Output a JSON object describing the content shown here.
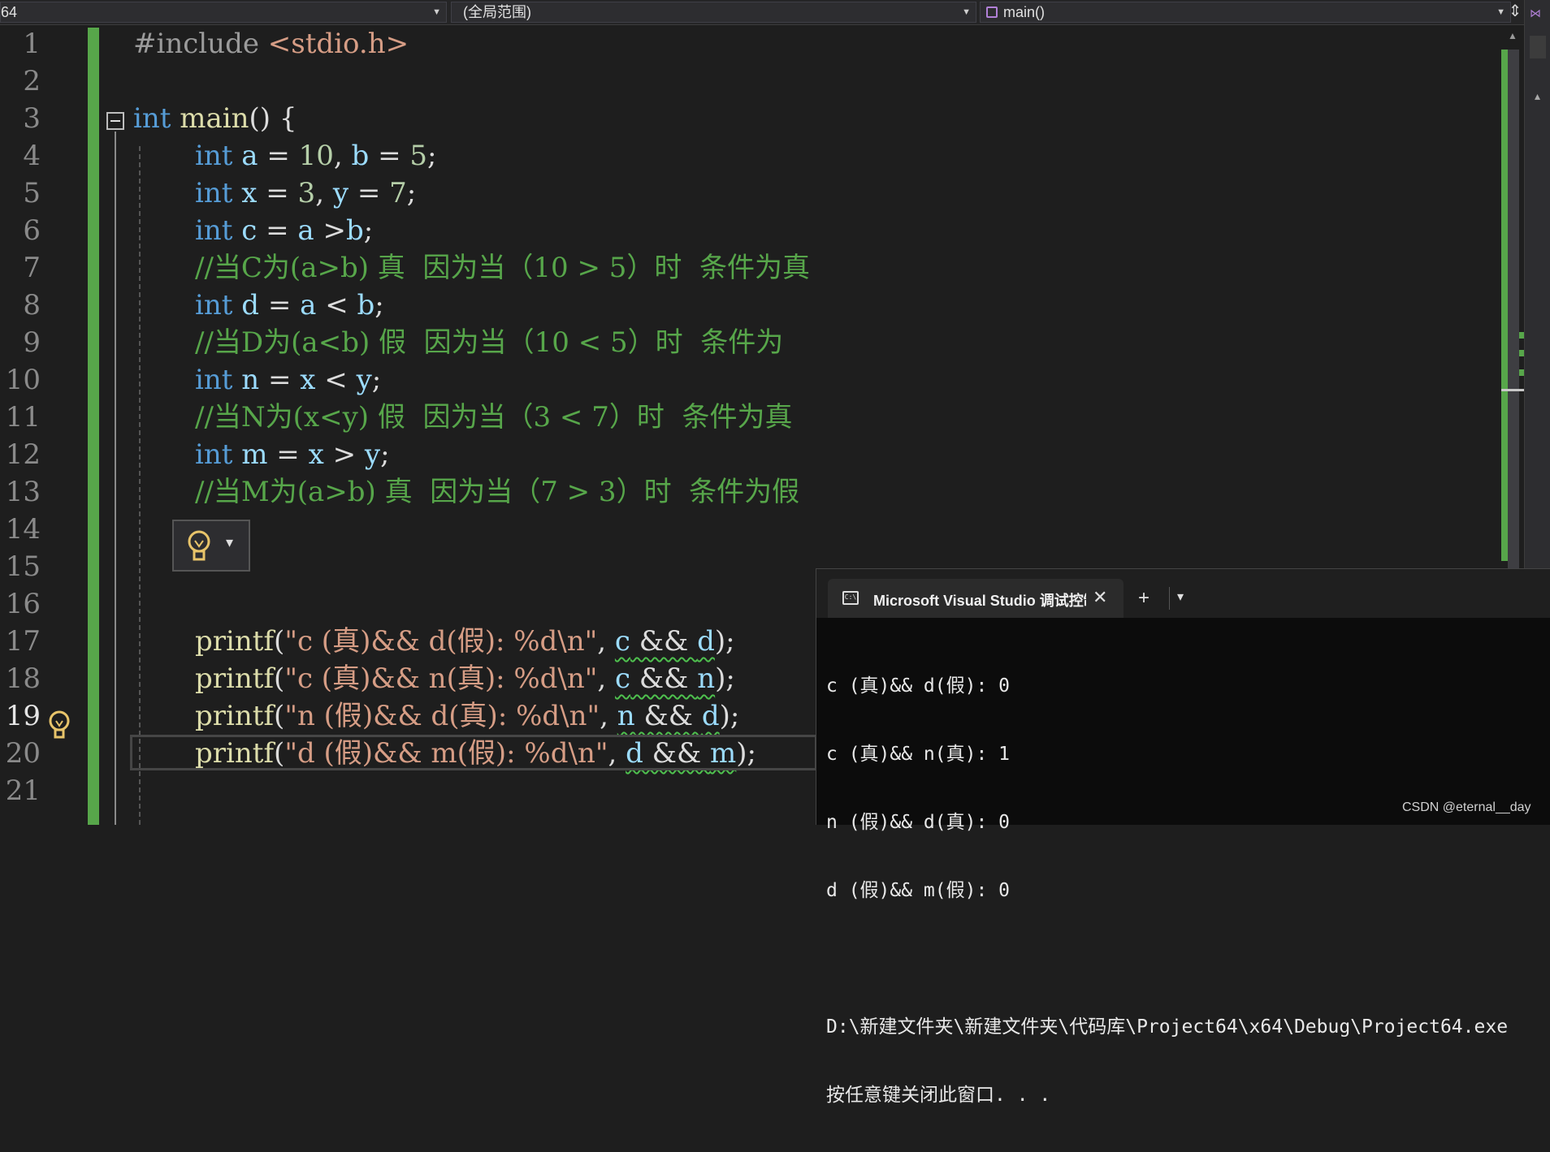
{
  "navbar": {
    "project": "64",
    "scope": "(全局范围)",
    "member": "main()"
  },
  "line_numbers": [
    "1",
    "2",
    "3",
    "4",
    "5",
    "6",
    "7",
    "8",
    "9",
    "10",
    "11",
    "12",
    "13",
    "14",
    "15",
    "16",
    "17",
    "18",
    "19",
    "20",
    "21"
  ],
  "code": {
    "l1_pp": "#include ",
    "l1_inc": "<stdio.h>",
    "l3_kw": "int",
    "l3_fn": "main",
    "l3_rest": "() {",
    "l4": {
      "kw": "int",
      "v1": "a",
      "op1": " = ",
      "n1": "10",
      "sep": ", ",
      "v2": "b",
      "op2": " = ",
      "n2": "5",
      "end": ";"
    },
    "l5": {
      "kw": "int",
      "v1": "x",
      "op1": " = ",
      "n1": "3",
      "sep": ", ",
      "v2": "y",
      "op2": " = ",
      "n2": "7",
      "end": ";"
    },
    "l6": {
      "kw": "int",
      "v1": "c",
      "op1": " = ",
      "v2": "a",
      "op2": " >",
      "v3": "b",
      "end": ";"
    },
    "l7_cmt": "//当C为(a>b) 真  因为当（10 > 5）时  条件为真",
    "l8": {
      "kw": "int",
      "v1": "d",
      "op1": " = ",
      "v2": "a",
      "op2": " < ",
      "v3": "b",
      "end": ";"
    },
    "l9_cmt": "//当D为(a<b) 假  因为当（10 < 5）时  条件为",
    "l10": {
      "kw": "int",
      "v1": "n",
      "op1": " = ",
      "v2": "x",
      "op2": " < ",
      "v3": "y",
      "end": ";"
    },
    "l11_cmt": "//当N为(x<y) 假  因为当（3 < 7）时  条件为真",
    "l12": {
      "kw": "int",
      "v1": "m",
      "op1": " = ",
      "v2": "x",
      "op2": " > ",
      "v3": "y",
      "end": ";"
    },
    "l13_cmt": "//当M为(a>b) 真  因为当（7 > 3）时  条件为假",
    "l16": {
      "fn": "printf",
      "open": "(",
      "str": "\"c (真)&& d(假): %d\\n\"",
      "sep": ", ",
      "a": "c",
      "op": " && ",
      "b": "d",
      "end": ");"
    },
    "l17": {
      "fn": "printf",
      "open": "(",
      "str": "\"c (真)&& n(真): %d\\n\"",
      "sep": ", ",
      "a": "c",
      "op": " && ",
      "b": "n",
      "end": ");"
    },
    "l18": {
      "fn": "printf",
      "open": "(",
      "str": "\"n (假)&& d(真): %d\\n\"",
      "sep": ", ",
      "a": "n",
      "op": " && ",
      "b": "d",
      "end": ");"
    },
    "l19": {
      "fn": "printf",
      "open": "(",
      "str": "\"d (假)&& m(假): %d\\n\"",
      "sep": ", ",
      "a": "d",
      "op": " && ",
      "b": "m",
      "end": ");"
    }
  },
  "console": {
    "tab_title": "Microsoft Visual Studio 调试控制台",
    "close": "✕",
    "plus": "+",
    "dropdown": "⌄",
    "lines": [
      "c (真)&& d(假): 0",
      "c (真)&& n(真): 1",
      "n (假)&& d(真): 0",
      "d (假)&& m(假): 0",
      "",
      "D:\\新建文件夹\\新建文件夹\\代码库\\Project64\\x64\\Debug\\Project64.exe",
      "按任意键关闭此窗口. . ."
    ]
  },
  "watermark": "CSDN @eternal__day",
  "colors": {
    "keyword": "#569cd6",
    "variable": "#9cdcfe",
    "function": "#dcdcaa",
    "number": "#b5cea8",
    "string": "#d69d85",
    "comment": "#57a64a"
  }
}
